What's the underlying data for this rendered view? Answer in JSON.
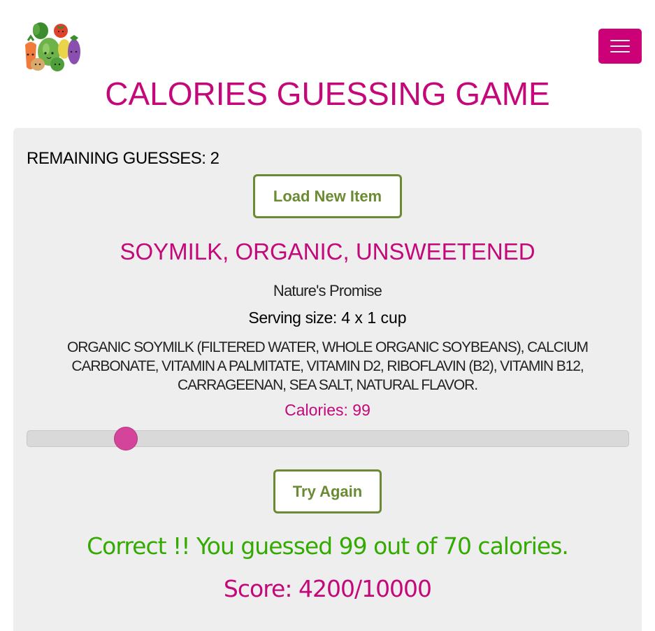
{
  "header": {
    "logo_icon": "vegetables-logo-icon",
    "menu_icon": "hamburger-menu-icon",
    "title": "CALORIES GUESSING GAME"
  },
  "game": {
    "remaining_label": "REMAINING GUESSES:",
    "remaining_count": "2",
    "load_button_label": "Load New Item",
    "product_name": "SOYMILK, ORGANIC, UNSWEETENED",
    "brand": "Nature's Promise",
    "serving_label": "Serving size:",
    "serving_value": "4 x 1 cup",
    "ingredients": "ORGANIC SOYMILK (FILTERED WATER, WHOLE ORGANIC SOYBEANS), CALCIUM CARBONATE, VITAMIN A PALMITATE, VITAMIN D2, RIBOFLAVIN (B2), VITAMIN B12, CARRAGEENAN, SEA SALT, NATURAL FLAVOR.",
    "calories_label": "Calories:",
    "calories_value": "99",
    "slider_fraction": 0.165,
    "try_button_label": "Try Again",
    "result_text": "Correct !! You guessed 99 out of 70 calories.",
    "score_label": "Score:",
    "score_value": "4200/10000"
  },
  "colors": {
    "accent": "#c4087a",
    "menu_bg": "#cc0077",
    "button_border": "#6b8a33",
    "success": "#33aa00",
    "panel_bg": "#eeeeee",
    "slider_thumb": "#d4449a"
  }
}
